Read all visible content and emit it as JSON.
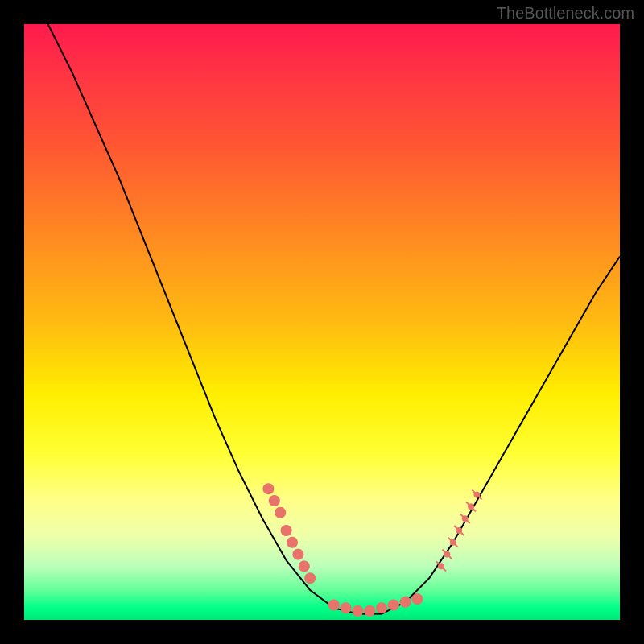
{
  "watermark": "TheBottleneck.com",
  "chart_data": {
    "type": "line",
    "title": "",
    "xlabel": "",
    "ylabel": "",
    "xlim": [
      0,
      100
    ],
    "ylim": [
      0,
      100
    ],
    "curve": [
      {
        "x": 4,
        "y": 100
      },
      {
        "x": 8,
        "y": 92
      },
      {
        "x": 12,
        "y": 83
      },
      {
        "x": 16,
        "y": 74
      },
      {
        "x": 20,
        "y": 64
      },
      {
        "x": 24,
        "y": 54
      },
      {
        "x": 28,
        "y": 44
      },
      {
        "x": 32,
        "y": 34
      },
      {
        "x": 36,
        "y": 25
      },
      {
        "x": 40,
        "y": 17
      },
      {
        "x": 44,
        "y": 10
      },
      {
        "x": 48,
        "y": 5
      },
      {
        "x": 52,
        "y": 2
      },
      {
        "x": 56,
        "y": 1
      },
      {
        "x": 60,
        "y": 1
      },
      {
        "x": 64,
        "y": 3
      },
      {
        "x": 68,
        "y": 7
      },
      {
        "x": 72,
        "y": 13
      },
      {
        "x": 76,
        "y": 20
      },
      {
        "x": 80,
        "y": 27
      },
      {
        "x": 84,
        "y": 34
      },
      {
        "x": 88,
        "y": 41
      },
      {
        "x": 92,
        "y": 48
      },
      {
        "x": 96,
        "y": 55
      },
      {
        "x": 100,
        "y": 61
      }
    ],
    "left_dots": [
      {
        "x": 41,
        "y": 22
      },
      {
        "x": 42,
        "y": 20
      },
      {
        "x": 43,
        "y": 18
      },
      {
        "x": 44,
        "y": 15
      },
      {
        "x": 45,
        "y": 13
      },
      {
        "x": 46,
        "y": 11
      },
      {
        "x": 47,
        "y": 9
      },
      {
        "x": 48,
        "y": 7
      }
    ],
    "bottom_dots": [
      {
        "x": 52,
        "y": 2.5
      },
      {
        "x": 54,
        "y": 2
      },
      {
        "x": 56,
        "y": 1.5
      },
      {
        "x": 58,
        "y": 1.5
      },
      {
        "x": 60,
        "y": 2
      },
      {
        "x": 62,
        "y": 2.5
      },
      {
        "x": 64,
        "y": 3
      },
      {
        "x": 66,
        "y": 3.5
      }
    ],
    "right_ticks": [
      {
        "x": 70,
        "y": 9
      },
      {
        "x": 71,
        "y": 11
      },
      {
        "x": 72,
        "y": 13
      },
      {
        "x": 73,
        "y": 15
      },
      {
        "x": 74,
        "y": 17
      },
      {
        "x": 75,
        "y": 19
      },
      {
        "x": 76,
        "y": 21
      }
    ]
  }
}
